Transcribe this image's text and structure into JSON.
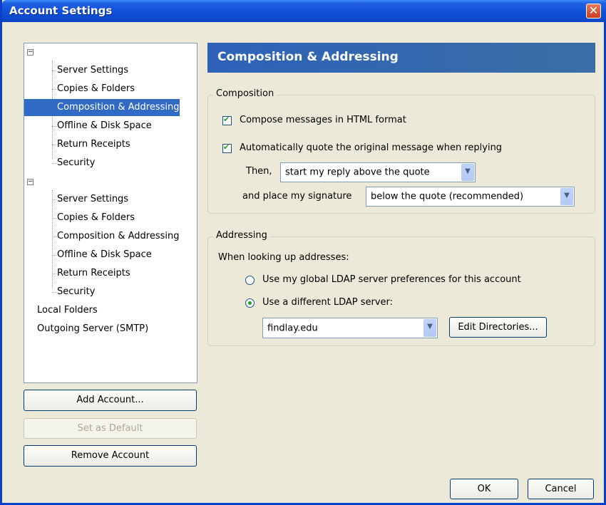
{
  "window": {
    "title": "Account Settings",
    "close_symbol": "✕"
  },
  "tree": {
    "accounts": [
      {
        "expander": "−",
        "items": [
          "Server Settings",
          "Copies & Folders",
          "Composition & Addressing",
          "Offline & Disk Space",
          "Return Receipts",
          "Security"
        ]
      },
      {
        "expander": "−",
        "items": [
          "Server Settings",
          "Copies & Folders",
          "Composition & Addressing",
          "Offline & Disk Space",
          "Return Receipts",
          "Security"
        ]
      }
    ],
    "local_folders": "Local Folders",
    "outgoing_server": "Outgoing Server (SMTP)",
    "selected": "Composition & Addressing"
  },
  "left_buttons": {
    "add_account": "Add Account...",
    "set_default": "Set as Default",
    "remove_account": "Remove Account"
  },
  "panel": {
    "title": "Composition & Addressing"
  },
  "composition": {
    "legend": "Composition",
    "html_format": {
      "label": "Compose messages in HTML format",
      "checked": true
    },
    "auto_quote": {
      "label": "Automatically quote the original message when replying",
      "checked": true
    },
    "then_label": "Then,",
    "reply_position": "start my reply above the quote",
    "signature_label": "and place my signature",
    "signature_position": "below the quote (recommended)"
  },
  "addressing": {
    "legend": "Addressing",
    "lookup_label": "When looking up addresses:",
    "global_ldap": {
      "label": "Use my global LDAP server preferences for this account",
      "selected": false
    },
    "different_ldap": {
      "label": "Use a different LDAP server:",
      "selected": true
    },
    "ldap_server": "findlay.edu",
    "edit_directories": "Edit Directories..."
  },
  "dialog_buttons": {
    "ok": "OK",
    "cancel": "Cancel"
  },
  "icons": {
    "checkbox": "check-icon",
    "dropdown": "chevron-down-icon",
    "tree_expander": "minus-icon"
  }
}
